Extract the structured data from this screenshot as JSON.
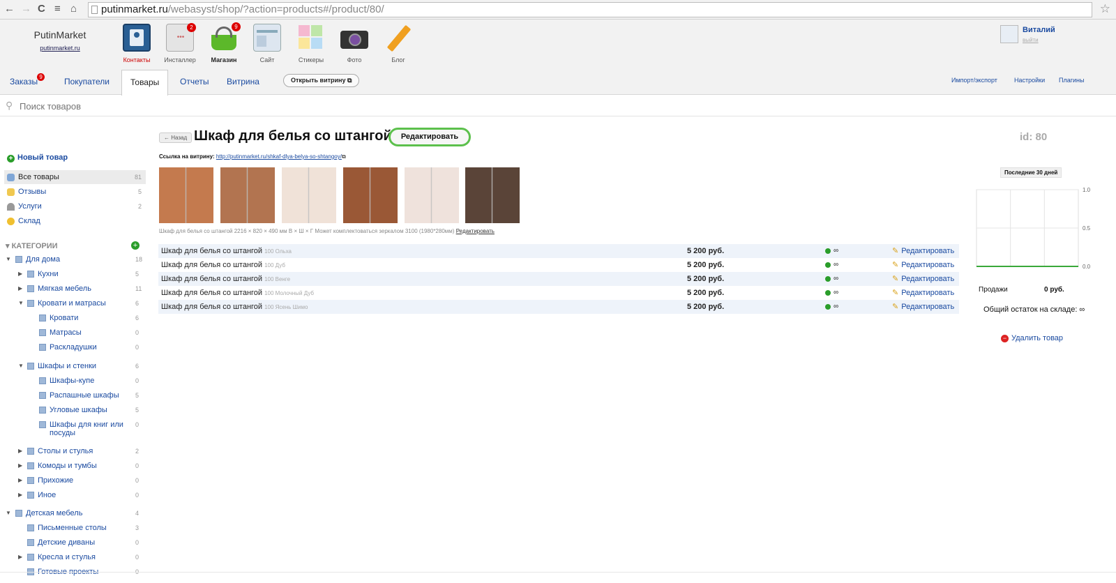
{
  "browser": {
    "url_host": "putinmarket.ru",
    "url_rest": "/webasyst/shop/?action=products#/product/80/",
    "back": "←",
    "forward": "→",
    "reload": "C",
    "menu": "≡",
    "home": "⌂",
    "star": "☆"
  },
  "brand": {
    "name": "PutinMarket",
    "url": "putinmarket.ru"
  },
  "apps": [
    {
      "label": "Контакты",
      "icon": "contacts-icon",
      "badge": ""
    },
    {
      "label": "Инсталлер",
      "icon": "installer-icon",
      "badge": "2"
    },
    {
      "label": "Магазин",
      "icon": "shop-basket-icon",
      "badge": "9"
    },
    {
      "label": "Сайт",
      "icon": "site-icon",
      "badge": ""
    },
    {
      "label": "Стикеры",
      "icon": "stickers-icon",
      "badge": ""
    },
    {
      "label": "Фото",
      "icon": "camera-icon",
      "badge": ""
    },
    {
      "label": "Блог",
      "icon": "pencil-icon",
      "badge": ""
    }
  ],
  "user": {
    "name": "Виталий",
    "exit": "выйти"
  },
  "tabs": {
    "orders": "Заказы",
    "orders_badge": "9",
    "customers": "Покупатели",
    "products": "Товары",
    "reports": "Отчеты",
    "storefront": "Витрина",
    "open_storefront": "Открыть витрину ⧉",
    "import_export": "Импорт/экспорт",
    "settings": "Настройки",
    "plugins": "Плагины"
  },
  "search": {
    "placeholder": "Поиск товаров"
  },
  "sidebar": {
    "new_product": "Новый товар",
    "items": [
      {
        "label": "Все товары",
        "count": "81"
      },
      {
        "label": "Отзывы",
        "count": "5"
      },
      {
        "label": "Услуги",
        "count": "2"
      },
      {
        "label": "Склад",
        "count": ""
      }
    ],
    "categories_header": "КАТЕГОРИИ",
    "categories": [
      {
        "label": "Для дома",
        "count": "18"
      },
      {
        "label": "Кухни",
        "count": "5"
      },
      {
        "label": "Мягкая мебель",
        "count": "11"
      },
      {
        "label": "Кровати и матрасы",
        "count": "6"
      },
      {
        "label": "Кровати",
        "count": "6"
      },
      {
        "label": "Матрасы",
        "count": "0"
      },
      {
        "label": "Раскладушки",
        "count": "0"
      },
      {
        "label": "Шкафы и стенки",
        "count": "6"
      },
      {
        "label": "Шкафы-купе",
        "count": "0"
      },
      {
        "label": "Распашные шкафы",
        "count": "5"
      },
      {
        "label": "Угловые шкафы",
        "count": "5"
      },
      {
        "label": "Шкафы для книг или",
        "label2": "посуды",
        "count": "0"
      },
      {
        "label": "Столы и стулья",
        "count": "2"
      },
      {
        "label": "Комоды и тумбы",
        "count": "0"
      },
      {
        "label": "Прихожие",
        "count": "0"
      },
      {
        "label": "Иное",
        "count": "0"
      },
      {
        "label": "Детская мебель",
        "count": "4"
      },
      {
        "label": "Письменные столы",
        "count": "3"
      },
      {
        "label": "Детские диваны",
        "count": "0"
      },
      {
        "label": "Кресла и стулья",
        "count": "0"
      },
      {
        "label": "Готовые проекты",
        "count": "0"
      }
    ]
  },
  "product": {
    "back": "← Назад",
    "title": "Шкаф для белья со штангой",
    "edit": "Редактировать",
    "id": "id: 80",
    "storefront_label": "Ссылка на витрину:",
    "storefront_url": "http://putinmarket.ru/shkaf-dlya-belya-so-shtangoy/",
    "description": "Шкаф для белья со штангой 2216 × 820 × 490 мм В × Ш × Г Может комплектоваться зеркалом 3100 (1980*280мм)",
    "description_edit": "Редактировать",
    "image_colors": [
      "#c47a4e",
      "#b27450",
      "#f0e2d8",
      "#9a5836",
      "#efe2dc",
      "#5a4438"
    ]
  },
  "variants": [
    {
      "name": "Шкаф для белья со штангой",
      "sku": "100 Ольха",
      "price": "5 200 руб.",
      "stock": "∞",
      "edit": "Редактировать"
    },
    {
      "name": "Шкаф для белья со штангой",
      "sku": "100 Дуб",
      "price": "5 200 руб.",
      "stock": "∞",
      "edit": "Редактировать"
    },
    {
      "name": "Шкаф для белья со штангой",
      "sku": "100 Венге",
      "price": "5 200 руб.",
      "stock": "∞",
      "edit": "Редактировать"
    },
    {
      "name": "Шкаф для белья со штангой",
      "sku": "100 Молочный Дуб",
      "price": "5 200 руб.",
      "stock": "∞",
      "edit": "Редактировать"
    },
    {
      "name": "Шкаф для белья со штангой",
      "sku": "100 Ясень Шимо",
      "price": "5 200 руб.",
      "stock": "∞",
      "edit": "Редактировать"
    }
  ],
  "stats": {
    "period": "Последние 30 дней",
    "sales_label": "Продажи",
    "sales_value": "0 руб.",
    "stock_label": "Общий остаток на складе: ∞",
    "delete": "Удалить товар"
  },
  "chart_data": {
    "type": "line",
    "title": "",
    "x": [],
    "series": [
      {
        "values": []
      }
    ],
    "ylim": [
      0.0,
      1.0
    ],
    "yticks": [
      "1.0",
      "0.5",
      "0.0"
    ],
    "grid": true,
    "line_color": "#3aa83a"
  }
}
